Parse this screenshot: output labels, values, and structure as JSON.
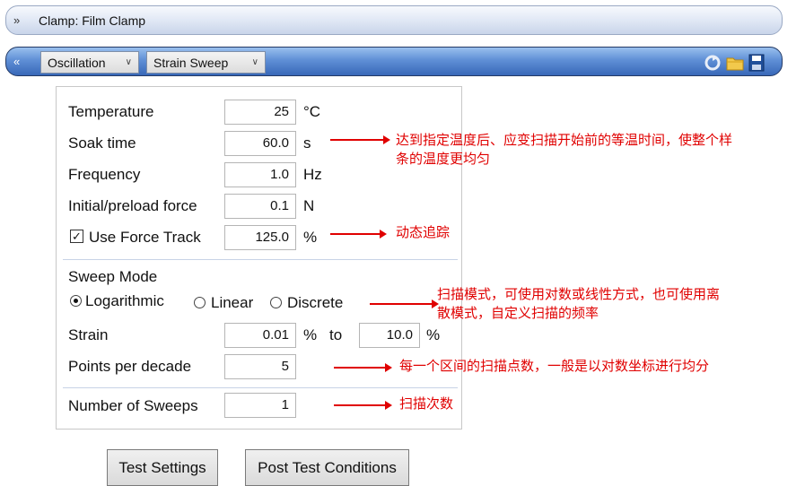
{
  "clamp_bar": {
    "chevron": "»",
    "title": "Clamp: Film Clamp"
  },
  "test_bar": {
    "chevron": "«",
    "mode_dropdown": "Oscillation",
    "test_dropdown": "Strain Sweep",
    "icons": [
      "refresh-icon",
      "folder-icon",
      "save-icon"
    ]
  },
  "settings": {
    "temperature": {
      "label": "Temperature",
      "value": "25",
      "unit": "°C"
    },
    "soak_time": {
      "label": "Soak time",
      "value": "60.0",
      "unit": "s"
    },
    "frequency": {
      "label": "Frequency",
      "value": "1.0",
      "unit": "Hz"
    },
    "preload_force": {
      "label": "Initial/preload force",
      "value": "0.1",
      "unit": "N"
    },
    "force_track": {
      "label": "Use Force Track",
      "checked": true,
      "check_mark": "✓",
      "value": "125.0",
      "unit": "%"
    },
    "sweep_mode": {
      "label": "Sweep Mode",
      "options": [
        "Logarithmic",
        "Linear",
        "Discrete"
      ],
      "selected": "Logarithmic"
    },
    "strain": {
      "label": "Strain",
      "from": "0.01",
      "from_unit": "%",
      "to_label": "to",
      "to": "10.0",
      "to_unit": "%"
    },
    "points_per_decade": {
      "label": "Points per decade",
      "value": "5"
    },
    "number_of_sweeps": {
      "label": "Number of Sweeps",
      "value": "1"
    }
  },
  "annotations": {
    "soak_time": [
      "达到指定温度后、应变扫描开始前的等温时间，使整个样",
      "条的温度更均匀"
    ],
    "force_track": [
      "动态追踪"
    ],
    "sweep_mode": [
      "扫描模式，可使用对数或线性方式，也可使用离",
      "散模式，自定义扫描的频率"
    ],
    "points_per_decade": [
      "每一个区间的扫描点数，一般是以对数坐标进行均分"
    ],
    "number_of_sweeps": [
      "扫描次数"
    ]
  },
  "buttons": {
    "test_settings": "Test Settings",
    "post_test_conditions": "Post Test Conditions"
  },
  "colors": {
    "annotation": "#e00000",
    "header_blue": "#4f80cc"
  }
}
